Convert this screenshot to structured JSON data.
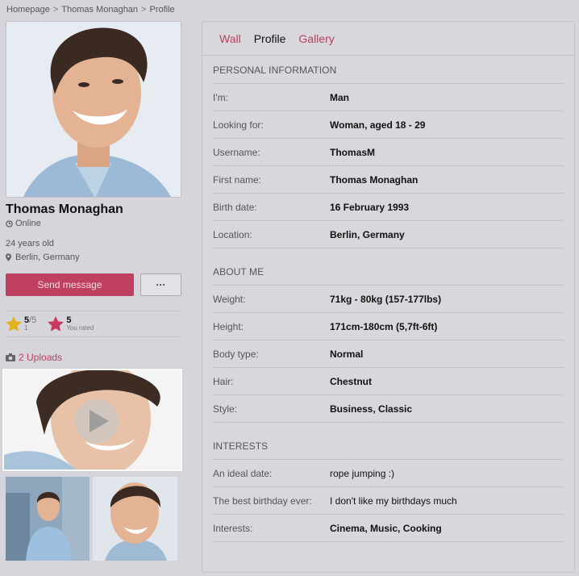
{
  "breadcrumb": [
    "Homepage",
    "Thomas Monaghan",
    "Profile"
  ],
  "profile": {
    "name": "Thomas Monaghan",
    "status": "Online",
    "age": "24 years old",
    "location": "Berlin, Germany",
    "send_label": "Send message",
    "more_label": "···",
    "rating": {
      "score": "5",
      "of": "/5",
      "count": "1"
    },
    "you_rated": {
      "score": "5",
      "label": "You rated"
    },
    "uploads_label": "2 Uploads"
  },
  "tabs": [
    {
      "label": "Wall",
      "active": false
    },
    {
      "label": "Profile",
      "active": true
    },
    {
      "label": "Gallery",
      "active": false
    }
  ],
  "sections": {
    "personal": {
      "title": "PERSONAL INFORMATION",
      "rows": [
        {
          "label": "I'm:",
          "value": "Man"
        },
        {
          "label": "Looking for:",
          "value": "Woman, aged 18 - 29"
        },
        {
          "label": "Username:",
          "value": "ThomasM"
        },
        {
          "label": "First name:",
          "value": "Thomas Monaghan"
        },
        {
          "label": "Birth date:",
          "value": "16 February 1993"
        },
        {
          "label": "Location:",
          "value": "Berlin, Germany"
        }
      ]
    },
    "about": {
      "title": "ABOUT ME",
      "rows": [
        {
          "label": "Weight:",
          "value": "71kg - 80kg (157-177lbs)"
        },
        {
          "label": "Height:",
          "value": "171cm-180cm (5,7ft-6ft)"
        },
        {
          "label": "Body type:",
          "value": "Normal"
        },
        {
          "label": "Hair:",
          "value": "Chestnut"
        },
        {
          "label": "Style:",
          "value": "Business, Classic"
        }
      ]
    },
    "interests": {
      "title": "INTERESTS",
      "rows": [
        {
          "label": "An ideal date:",
          "value": "rope jumping :)"
        },
        {
          "label": "The best birthday ever:",
          "value": "I don't like my birthdays much"
        },
        {
          "label": "Interests:",
          "value": "Cinema, Music, Cooking"
        }
      ]
    }
  },
  "colors": {
    "accent": "#c04062",
    "star": "#e3b21b",
    "star_rated": "#c8385c"
  },
  "icons": [
    "clock-icon",
    "location-pin-icon",
    "star-icon",
    "camera-icon",
    "play-icon"
  ]
}
